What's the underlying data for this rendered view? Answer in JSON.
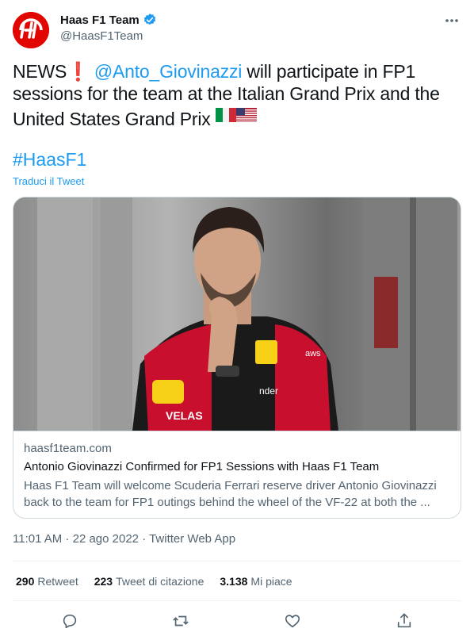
{
  "header": {
    "display_name": "Haas F1 Team",
    "handle": "@HaasF1Team",
    "more_label": "···"
  },
  "tweet": {
    "news": "NEWS",
    "exclamation": "❗",
    "mention": "@Anto_Giovinazzi",
    "text_after_mention": " will participate in FP1 sessions for the team at the Italian Grand Prix and the United States Grand Prix ",
    "hashtag": "#HaasF1",
    "translate_label": "Traduci il Tweet"
  },
  "card": {
    "domain": "haasf1team.com",
    "title": "Antonio Giovinazzi Confirmed for FP1 Sessions with Haas F1 Team",
    "description": "Haas F1 Team will welcome Scuderia Ferrari reserve driver Antonio Giovinazzi back to the team for FP1 outings behind the wheel of the VF-22 at both the ...",
    "image_shirt_text": "VELAS",
    "image_sponsor_text": "nder",
    "image_aws": "aws"
  },
  "meta": {
    "time": "11:01 AM",
    "date": "22 ago 2022",
    "source": "Twitter Web App",
    "separator": " · "
  },
  "stats": [
    {
      "count": "290",
      "label": "Retweet"
    },
    {
      "count": "223",
      "label": "Tweet di citazione"
    },
    {
      "count": "3.138",
      "label": "Mi piace"
    }
  ],
  "colors": {
    "accent": "#1d9bf0",
    "haas_red": "#e10600",
    "secondary_text": "#536471"
  }
}
